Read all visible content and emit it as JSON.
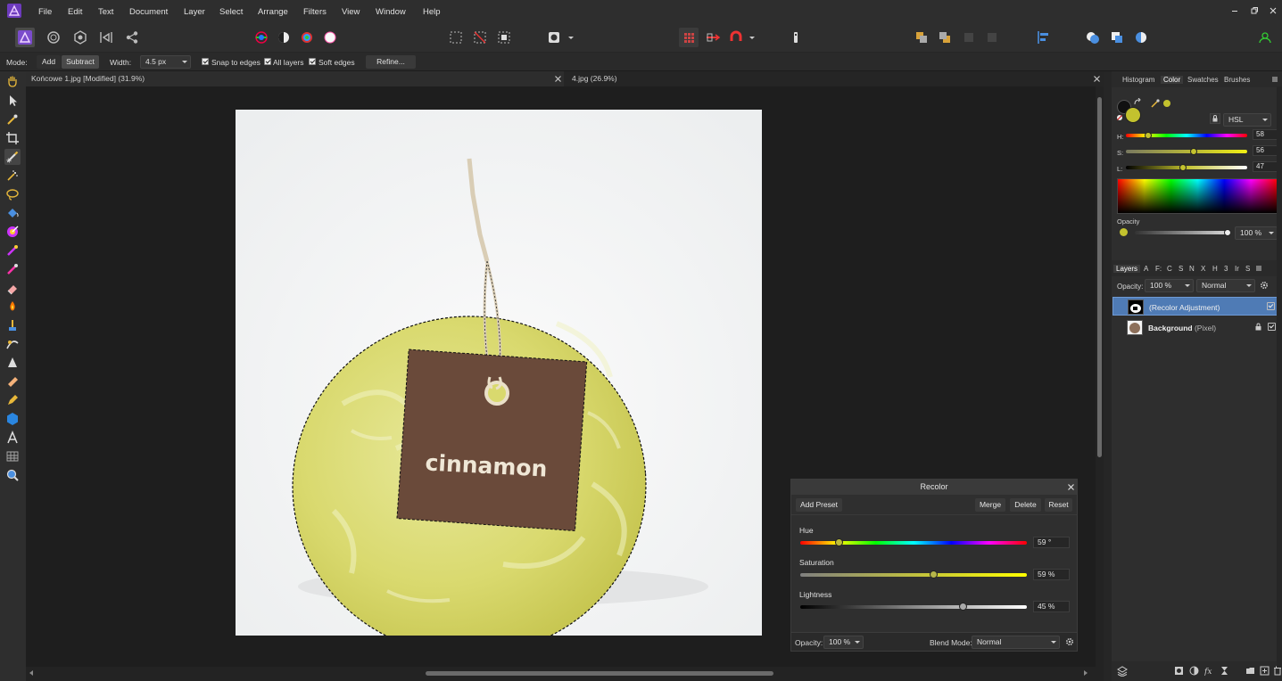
{
  "menubar": {
    "items": [
      "File",
      "Edit",
      "Text",
      "Document",
      "Layer",
      "Select",
      "Arrange",
      "Filters",
      "View",
      "Window",
      "Help"
    ]
  },
  "context_bar": {
    "mode_label": "Mode:",
    "mode_add": "Add",
    "mode_subtract": "Subtract",
    "width_label": "Width:",
    "width_value": "4.5 px",
    "snap_to_edges": "Snap to edges",
    "all_layers": "All layers",
    "soft_edges": "Soft edges",
    "refine": "Refine..."
  },
  "documents": {
    "tabs": [
      {
        "label": "Końcowe 1.jpg [Modified] (31.9%)"
      },
      {
        "label": "4.jpg (26.9%)"
      }
    ]
  },
  "photo": {
    "tag_text": "cinnamon"
  },
  "recolor": {
    "title": "Recolor",
    "add_preset": "Add Preset",
    "merge": "Merge",
    "delete": "Delete",
    "reset": "Reset",
    "hue_label": "Hue",
    "hue_value": "59 °",
    "hue_fraction": 0.17,
    "saturation_label": "Saturation",
    "saturation_value": "59 %",
    "saturation_fraction": 0.59,
    "lightness_label": "Lightness",
    "lightness_value": "45 %",
    "lightness_fraction": 0.72,
    "opacity_label": "Opacity:",
    "opacity_value": "100 %",
    "blend_label": "Blend Mode:",
    "blend_value": "Normal"
  },
  "color_panel": {
    "tabs": [
      "Histogram",
      "Color",
      "Swatches",
      "Brushes"
    ],
    "active_tab": "Color",
    "model": "HSL",
    "h_label": "H:",
    "h_value": "58",
    "s_label": "S:",
    "s_value": "56",
    "l_label": "L:",
    "l_value": "47",
    "opacity_label": "Opacity",
    "opacity_value": "100 %",
    "fill_color": "#c3c22e"
  },
  "layers_panel": {
    "tabs": [
      "Layers",
      "A",
      "F:",
      "C",
      "S",
      "N",
      "X",
      "H",
      "3",
      "Ir",
      "S"
    ],
    "opacity_label": "Opacity:",
    "opacity_value": "100 %",
    "blend_value": "Normal",
    "layers": [
      {
        "name": "(Recolor Adjustment)",
        "type": ""
      },
      {
        "name": "Background",
        "type": "(Pixel)"
      }
    ]
  }
}
